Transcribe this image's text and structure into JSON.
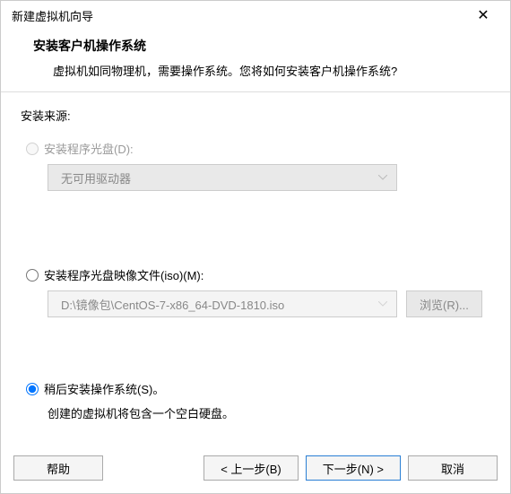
{
  "window": {
    "title": "新建虚拟机向导",
    "close_glyph": "✕"
  },
  "header": {
    "title": "安装客户机操作系统",
    "subtitle": "虚拟机如同物理机，需要操作系统。您将如何安装客户机操作系统?"
  },
  "section_label": "安装来源:",
  "options": {
    "disc": {
      "label": "安装程序光盘(D):",
      "dropdown_value": "无可用驱动器"
    },
    "iso": {
      "label": "安装程序光盘映像文件(iso)(M):",
      "path_value": "D:\\镜像包\\CentOS-7-x86_64-DVD-1810.iso",
      "browse_label": "浏览(R)..."
    },
    "later": {
      "label": "稍后安装操作系统(S)。",
      "hint": "创建的虚拟机将包含一个空白硬盘。"
    }
  },
  "footer": {
    "help": "帮助",
    "back": "< 上一步(B)",
    "next": "下一步(N) >",
    "cancel": "取消"
  }
}
